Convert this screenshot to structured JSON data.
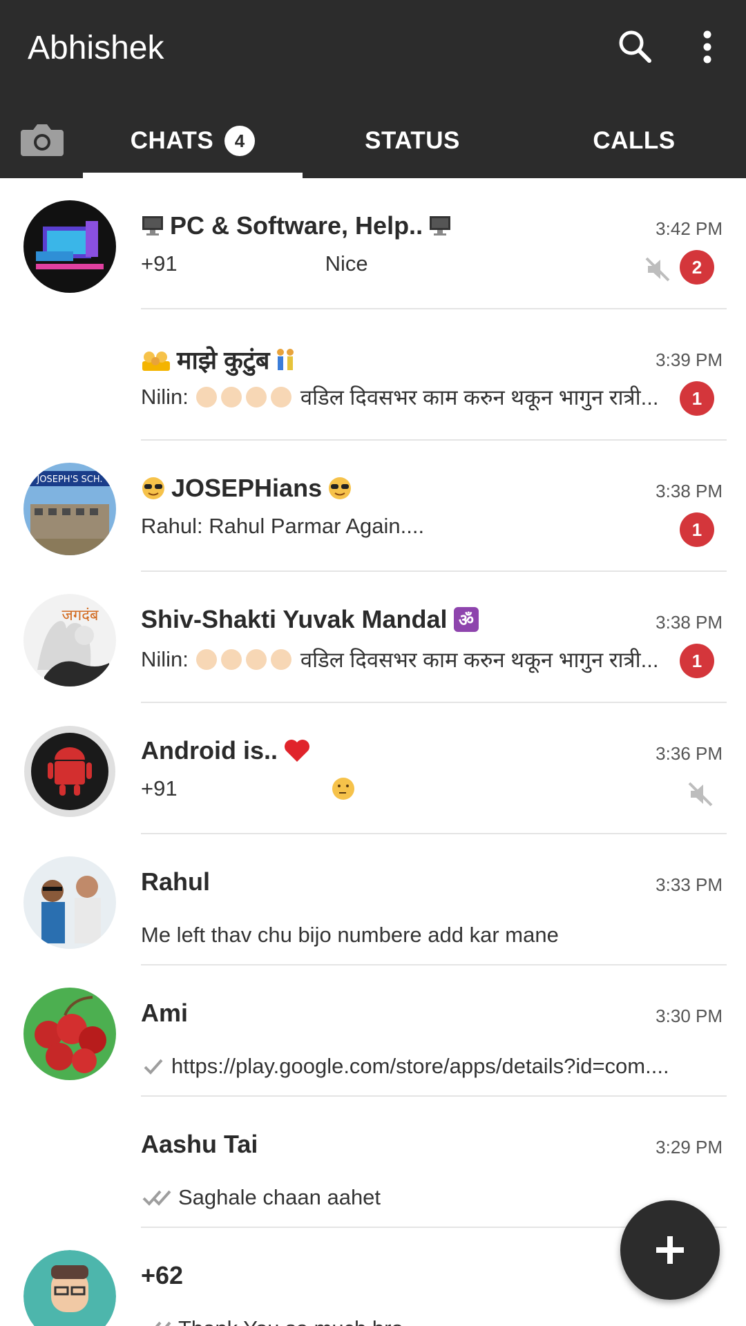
{
  "app": {
    "title": "Abhishek"
  },
  "tabs": {
    "chats": {
      "label": "CHATS",
      "badge": "4"
    },
    "status": {
      "label": "STATUS"
    },
    "calls": {
      "label": "CALLS"
    }
  },
  "chats": [
    {
      "name": "PC & Software, Help..",
      "time": "3:42 PM",
      "sender": "+91",
      "message": "Nice",
      "unread": "2",
      "muted": true
    },
    {
      "name": "माझे कुटुंब",
      "time": "3:39 PM",
      "sender": "Nilin:",
      "message": "वडिल दिवसभर काम करुन थकून भागुन रात्री...",
      "unread": "1"
    },
    {
      "name": "JOSEPHians",
      "time": "3:38 PM",
      "message": "Rahul: Rahul Parmar Again....",
      "unread": "1"
    },
    {
      "name": "Shiv-Shakti Yuvak Mandal",
      "time": "3:38 PM",
      "sender": "Nilin:",
      "message": "वडिल दिवसभर काम करुन थकून भागुन रात्री...",
      "unread": "1"
    },
    {
      "name": "Android is..",
      "time": "3:36 PM",
      "sender": "+91",
      "muted": true
    },
    {
      "name": "Rahul",
      "time": "3:33 PM",
      "message": "Me left thav chu bijo numbere add kar mane"
    },
    {
      "name": "Ami",
      "time": "3:30 PM",
      "message": "https://play.google.com/store/apps/details?id=com...."
    },
    {
      "name": "Aashu Tai",
      "time": "3:29 PM",
      "message": "Saghale chaan aahet"
    },
    {
      "name": "+62",
      "message": "Thank You so much bro"
    }
  ],
  "avatar_texts": {
    "school_banner": "JOSEPH'S SCH.",
    "jagdamb": "जगदंब"
  },
  "colors": {
    "appbar": "#2c2c2c",
    "unread_badge": "#d4363b",
    "background": "#ffffff"
  },
  "icons": [
    "camera-icon",
    "search-icon",
    "more-vert-icon",
    "mute-icon",
    "check-icon",
    "double-check-icon",
    "add-icon"
  ]
}
